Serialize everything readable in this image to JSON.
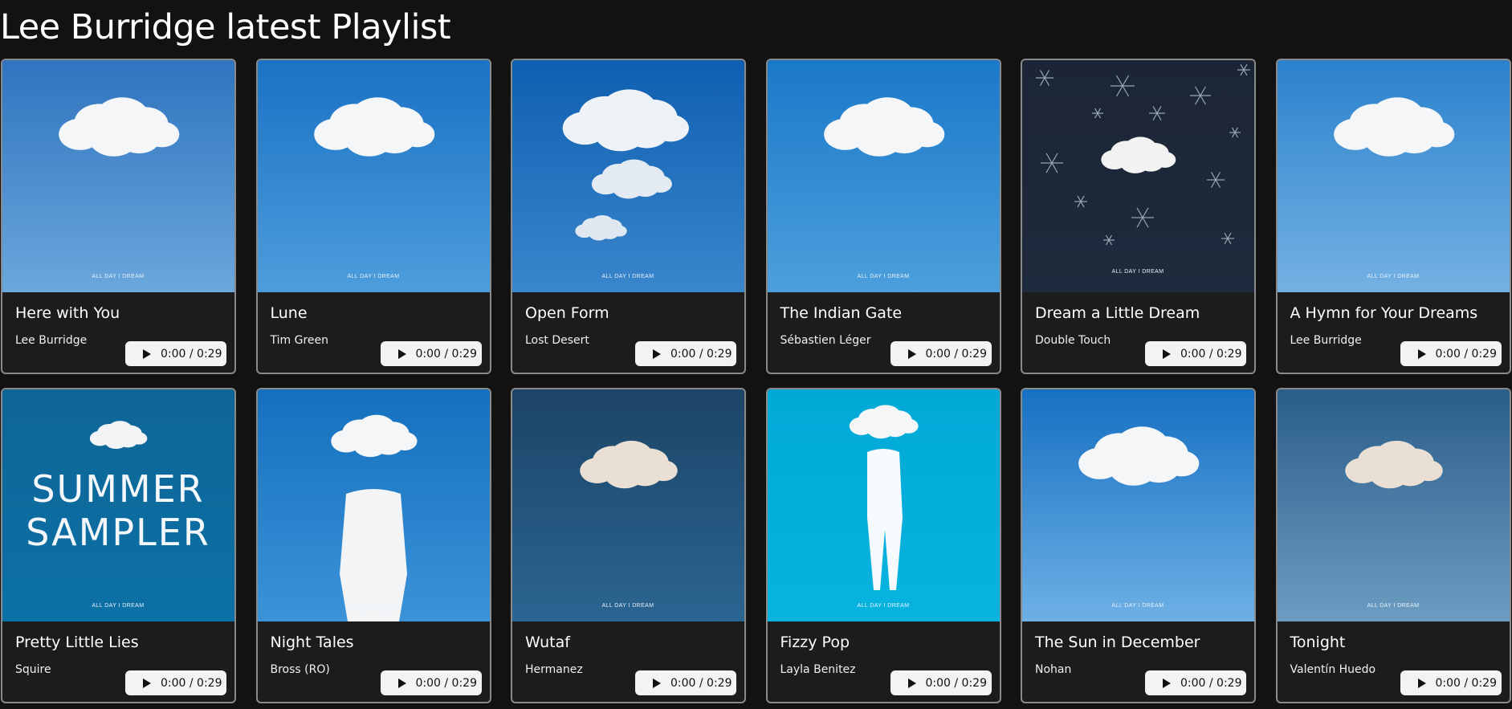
{
  "page": {
    "title": "Lee Burridge latest Playlist"
  },
  "brand_text": "ALL DAY I DREAM",
  "tracks": [
    {
      "title": "Here with You",
      "artist": "Lee Burridge",
      "time": "0:00 / 0:29",
      "art": "sky-cloud",
      "colors": [
        "#2f74bf",
        "#6aa7dc"
      ]
    },
    {
      "title": "Lune",
      "artist": "Tim Green",
      "time": "0:00 / 0:29",
      "art": "sky-cloud",
      "colors": [
        "#1a72c4",
        "#4d9ddc"
      ]
    },
    {
      "title": "Open Form",
      "artist": "Lost Desert",
      "time": "0:00 / 0:29",
      "art": "tall-cloud",
      "colors": [
        "#0f5fb1",
        "#3a86cc"
      ]
    },
    {
      "title": "The Indian Gate",
      "artist": "Sébastien Léger",
      "time": "0:00 / 0:29",
      "art": "sky-cloud",
      "colors": [
        "#1a79c9",
        "#4c9fdb"
      ]
    },
    {
      "title": "Dream a Little Dream",
      "artist": "Double Touch",
      "time": "0:00 / 0:29",
      "art": "snowflakes",
      "colors": [
        "#1b2536",
        "#1e2a3d"
      ]
    },
    {
      "title": "A Hymn for Your Dreams",
      "artist": "Lee Burridge",
      "time": "0:00 / 0:29",
      "art": "sky-cloud",
      "colors": [
        "#2b82cd",
        "#74b1e3"
      ]
    },
    {
      "title": "Pretty Little Lies",
      "artist": "Squire",
      "time": "0:00 / 0:29",
      "art": "summer-sampler",
      "colors": [
        "#0e6597",
        "#0c71a6"
      ]
    },
    {
      "title": "Night Tales",
      "artist": "Bross (RO)",
      "time": "0:00 / 0:29",
      "art": "person",
      "colors": [
        "#1470be",
        "#3b93d8"
      ]
    },
    {
      "title": "Wutaf",
      "artist": "Hermanez",
      "time": "0:00 / 0:29",
      "art": "dark-cloud",
      "colors": [
        "#1c4466",
        "#2b6592"
      ]
    },
    {
      "title": "Fizzy Pop",
      "artist": "Layla Benitez",
      "time": "0:00 / 0:29",
      "art": "cyan-person",
      "colors": [
        "#00a9d6",
        "#07b3df"
      ]
    },
    {
      "title": "The Sun in December",
      "artist": "Nohan",
      "time": "0:00 / 0:29",
      "art": "sky-cloud",
      "colors": [
        "#1670c2",
        "#6db0e5"
      ]
    },
    {
      "title": "Tonight",
      "artist": "Valentín Huedo",
      "time": "0:00 / 0:29",
      "art": "dark-cloud",
      "colors": [
        "#2a5d8a",
        "#6c9cc1"
      ]
    }
  ],
  "summer_sampler_lines": [
    "SUMMER",
    "SAMPLER"
  ],
  "icons": {
    "play": "play-icon"
  }
}
